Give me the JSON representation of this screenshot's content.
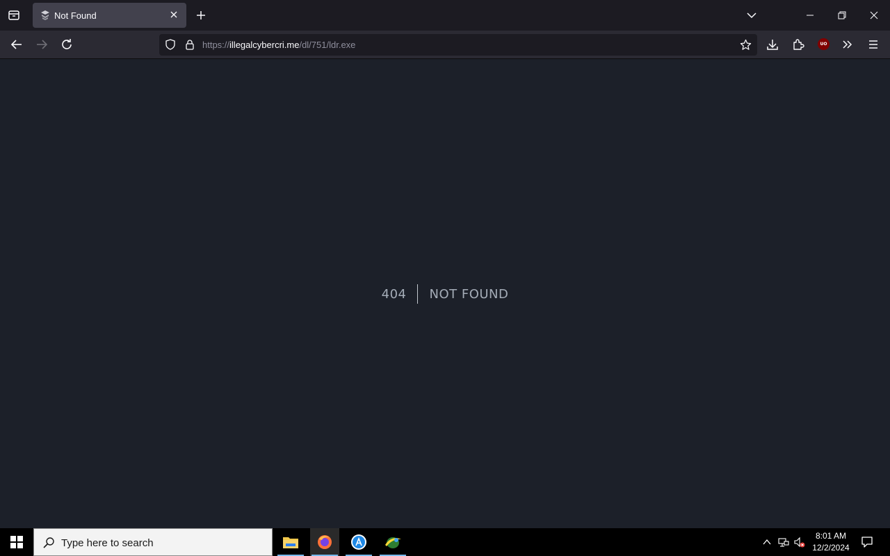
{
  "browser": {
    "tab": {
      "title": "Not Found"
    },
    "url": {
      "scheme": "https://",
      "host": "illegalcybercri.me",
      "path": "/dl/751/ldr.exe"
    },
    "extension_badge": "UO"
  },
  "page": {
    "error_code": "404",
    "error_message": "NOT FOUND"
  },
  "taskbar": {
    "search_placeholder": "Type here to search",
    "time": "8:01 AM",
    "date": "12/2/2024",
    "apps": [
      "file-explorer",
      "firefox",
      "app-store",
      "network-app"
    ]
  }
}
